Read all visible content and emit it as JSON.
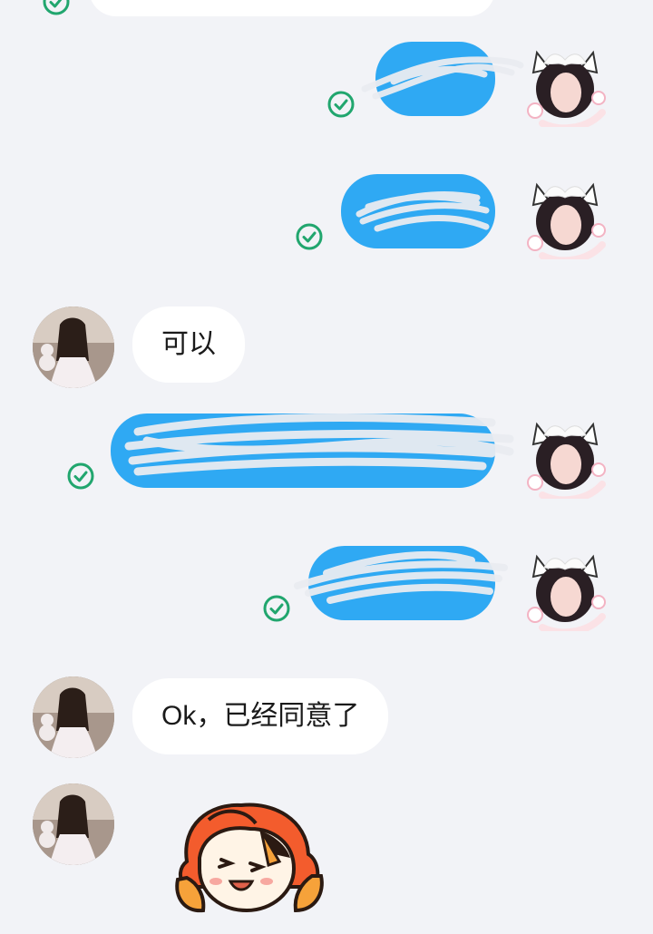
{
  "chat": {
    "messages": [
      {
        "side": "out",
        "text": "",
        "status": "read"
      },
      {
        "side": "out",
        "text": "",
        "status": "read"
      },
      {
        "side": "in",
        "text": "可以"
      },
      {
        "side": "out",
        "text": "",
        "status": "read"
      },
      {
        "side": "out",
        "text": "",
        "status": "read"
      },
      {
        "side": "in",
        "text": "Ok，已经同意了"
      },
      {
        "side": "in",
        "sticker": "cartoon-character-sticker"
      }
    ]
  },
  "colors": {
    "background": "#f2f3f7",
    "outgoing_bubble": "#2fa9f3",
    "incoming_bubble": "#ffffff",
    "read_check": "#21a66e"
  }
}
